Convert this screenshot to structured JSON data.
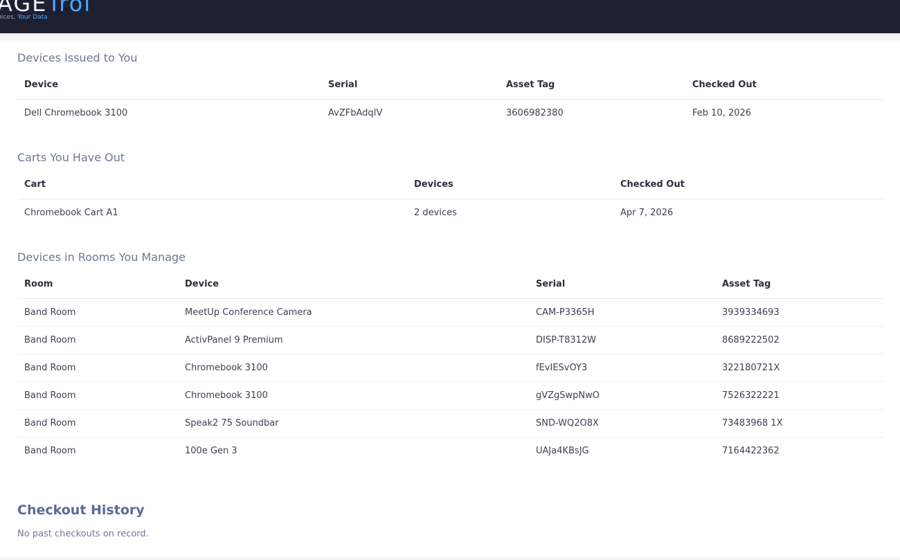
{
  "header": {
    "logo_text_visible": "AGE",
    "logo_text_accent": "Trol",
    "logo_tagline_prefix": "uices,",
    "logo_tagline_accent": "Your Data"
  },
  "devices_issued": {
    "title": "Devices Issued to You",
    "columns": [
      "Device",
      "Serial",
      "Asset Tag",
      "Checked Out"
    ],
    "rows": [
      [
        "Dell Chromebook 3100",
        "AvZFbAdqIV",
        "3606982380",
        "Feb 10, 2026"
      ]
    ]
  },
  "carts": {
    "title": "Carts You Have Out",
    "columns": [
      "Cart",
      "Devices",
      "Checked Out"
    ],
    "rows": [
      [
        "Chromebook Cart A1",
        "2 devices",
        "Apr 7, 2026"
      ]
    ]
  },
  "rooms": {
    "title": "Devices in Rooms You Manage",
    "columns": [
      "Room",
      "Device",
      "Serial",
      "Asset Tag"
    ],
    "rows": [
      [
        "Band Room",
        "MeetUp Conference Camera",
        "CAM-P3365H",
        "3939334693"
      ],
      [
        "Band Room",
        "ActivPanel 9 Premium",
        "DISP-T8312W",
        "8689222502"
      ],
      [
        "Band Room",
        "Chromebook 3100",
        "fEvIESvOY3",
        "322180721X"
      ],
      [
        "Band Room",
        "Chromebook 3100",
        "gVZgSwpNwO",
        "7526322221"
      ],
      [
        "Band Room",
        "Speak2 75 Soundbar",
        "SND-WQ2O8X",
        "73483968 1X"
      ],
      [
        "Band Room",
        "100e Gen 3",
        "UAJa4KBsJG",
        "7164422362"
      ]
    ]
  },
  "history": {
    "title": "Checkout History",
    "empty_text": "No past checkouts on record."
  }
}
